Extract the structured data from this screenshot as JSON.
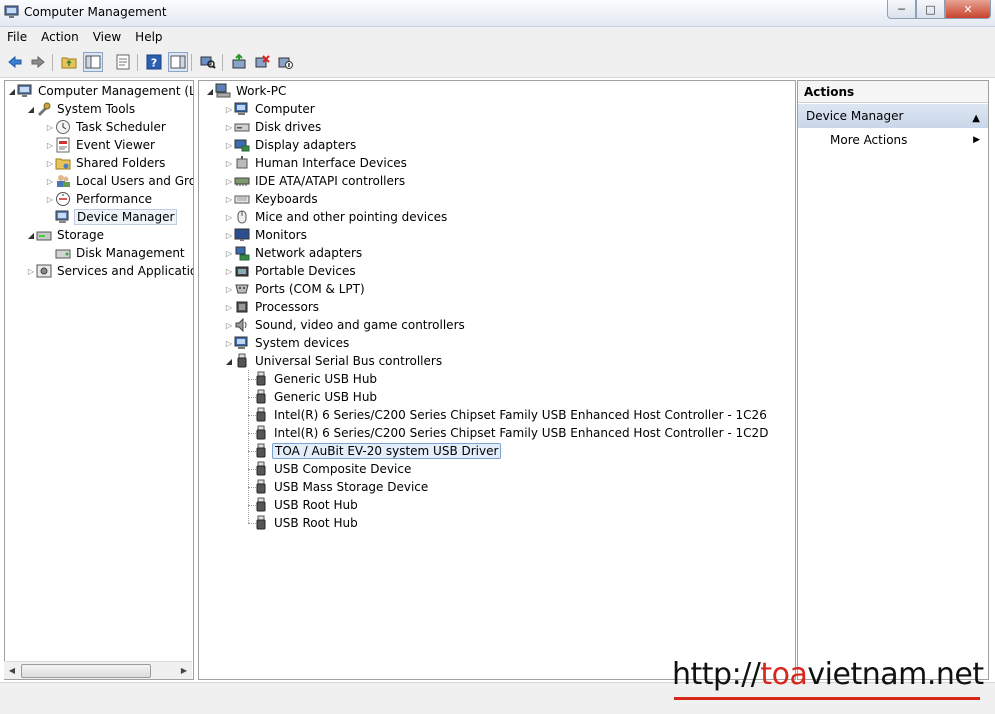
{
  "window": {
    "title": "Computer Management"
  },
  "menu": [
    "File",
    "Action",
    "View",
    "Help"
  ],
  "left_tree": [
    {
      "label": "Computer Management (Local",
      "level": 0,
      "expander": "open",
      "icon": "computer-management-icon"
    },
    {
      "label": "System Tools",
      "level": 1,
      "expander": "open",
      "icon": "system-tools-icon"
    },
    {
      "label": "Task Scheduler",
      "level": 2,
      "expander": "closed",
      "icon": "clock-icon"
    },
    {
      "label": "Event Viewer",
      "level": 2,
      "expander": "closed",
      "icon": "event-viewer-icon"
    },
    {
      "label": "Shared Folders",
      "level": 2,
      "expander": "closed",
      "icon": "shared-folder-icon"
    },
    {
      "label": "Local Users and Groups",
      "level": 2,
      "expander": "closed",
      "icon": "users-icon"
    },
    {
      "label": "Performance",
      "level": 2,
      "expander": "closed",
      "icon": "performance-icon"
    },
    {
      "label": "Device Manager",
      "level": 2,
      "expander": "none",
      "icon": "device-manager-icon",
      "selected": true
    },
    {
      "label": "Storage",
      "level": 1,
      "expander": "open",
      "icon": "storage-icon"
    },
    {
      "label": "Disk Management",
      "level": 2,
      "expander": "none",
      "icon": "disk-management-icon"
    },
    {
      "label": "Services and Applications",
      "level": 1,
      "expander": "closed",
      "icon": "services-icon"
    }
  ],
  "device_tree": {
    "root": "Work-PC",
    "categories": [
      {
        "label": "Computer",
        "icon": "computer-icon"
      },
      {
        "label": "Disk drives",
        "icon": "disk-drive-icon"
      },
      {
        "label": "Display adapters",
        "icon": "display-adapter-icon"
      },
      {
        "label": "Human Interface Devices",
        "icon": "hid-icon"
      },
      {
        "label": "IDE ATA/ATAPI controllers",
        "icon": "ide-icon"
      },
      {
        "label": "Keyboards",
        "icon": "keyboard-icon"
      },
      {
        "label": "Mice and other pointing devices",
        "icon": "mouse-icon"
      },
      {
        "label": "Monitors",
        "icon": "monitor-icon"
      },
      {
        "label": "Network adapters",
        "icon": "network-adapter-icon"
      },
      {
        "label": "Portable Devices",
        "icon": "portable-device-icon"
      },
      {
        "label": "Ports (COM & LPT)",
        "icon": "port-icon"
      },
      {
        "label": "Processors",
        "icon": "processor-icon"
      },
      {
        "label": "Sound, video and game controllers",
        "icon": "sound-icon"
      },
      {
        "label": "System devices",
        "icon": "system-device-icon"
      },
      {
        "label": "Universal Serial Bus controllers",
        "icon": "usb-icon",
        "expanded": true
      }
    ],
    "usb_children": [
      "Generic USB Hub",
      "Generic USB Hub",
      "Intel(R) 6 Series/C200 Series Chipset Family USB Enhanced Host Controller - 1C26",
      "Intel(R) 6 Series/C200 Series Chipset Family USB Enhanced Host Controller - 1C2D",
      "TOA / AuBit EV-20 system USB Driver",
      "USB Composite Device",
      "USB Mass Storage Device",
      "USB Root Hub",
      "USB Root Hub"
    ],
    "highlighted_child": "TOA / AuBit EV-20 system USB Driver"
  },
  "actions": {
    "header": "Actions",
    "section": "Device Manager",
    "more": "More Actions"
  },
  "watermark": {
    "prefix": "http://",
    "accent": "toa",
    "rest": "vietnam.net"
  }
}
